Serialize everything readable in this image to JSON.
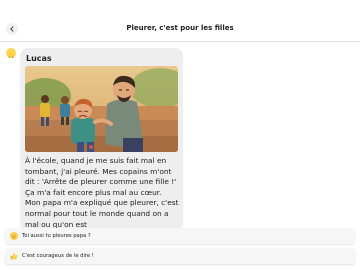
{
  "header": {
    "title": "Pleurer, c'est pour les filles",
    "back_icon": "chevron-left-icon"
  },
  "message": {
    "sender": "Lucas",
    "avatar_icon": "smiling-face-icon",
    "image_icon": "illustration-father-comforting-crying-boy",
    "text": "À l'école, quand je me suis fait mal en tombant, j'ai pleuré. Mes copains m'ont dit : 'Arrête de pleurer comme une fille !' Ça m'a fait encore plus mal au cœur. Mon papa m'a expliqué que pleurer, c'est normal pour tout le monde quand on a mal ou qu'on est"
  },
  "suggestions": [
    {
      "text": "Toi aussi tu pleures papa ?",
      "icon": "crying-face-icon"
    },
    {
      "text": "C'est courageux de le dire !",
      "icon": "thumbs-up-icon"
    }
  ],
  "colors": {
    "bubble_bg": "#eeeeee",
    "suggestion_bg": "#f6f6f6",
    "header_bg": "#ffffff",
    "emoji_yellow": "#ffd451"
  }
}
